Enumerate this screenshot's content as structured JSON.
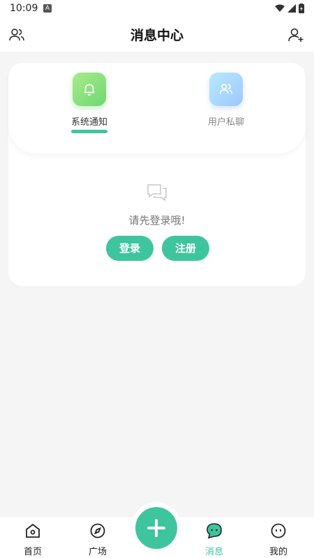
{
  "status_bar": {
    "time": "10:09",
    "app_badge": "A"
  },
  "header": {
    "title": "消息中心",
    "left_icon": "users-icon",
    "right_icon": "user-add-icon"
  },
  "tabs": [
    {
      "label": "系统通知",
      "icon": "bell-icon",
      "active": true
    },
    {
      "label": "用户私聊",
      "icon": "users-icon",
      "active": false
    }
  ],
  "empty_state": {
    "icon": "chat-bubbles-icon",
    "message": "请先登录哦!"
  },
  "buttons": {
    "login": "登录",
    "register": "注册"
  },
  "bottom_nav": [
    {
      "label": "首页",
      "icon": "home-icon"
    },
    {
      "label": "广场",
      "icon": "compass-icon"
    },
    {
      "label": "消息",
      "icon": "message-icon",
      "active": true
    },
    {
      "label": "我的",
      "icon": "face-icon"
    }
  ],
  "fab": {
    "icon": "plus-icon"
  },
  "colors": {
    "accent": "#3ec59e",
    "background": "#f5f5f5"
  }
}
